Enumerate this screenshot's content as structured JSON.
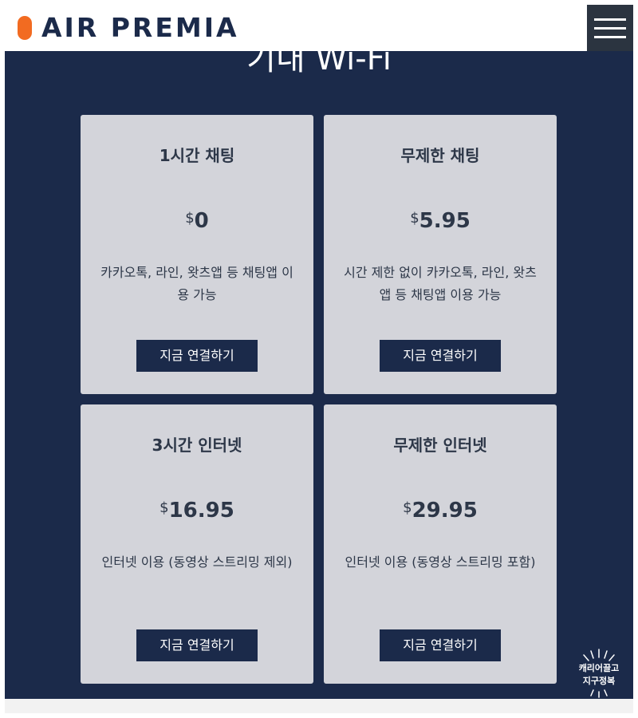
{
  "header": {
    "logo_text": "AIR PREMIA",
    "menu_icon": "hamburger-menu-icon",
    "brand_color": "#f26b21"
  },
  "section": {
    "title": "기내 Wi-Fi"
  },
  "plans": [
    {
      "title": "1시간 채팅",
      "currency": "$",
      "price": "0",
      "description": "카카오톡, 라인, 왓츠앱 등 채팅앱 이용 가능",
      "button_label": "지금 연결하기"
    },
    {
      "title": "무제한 채팅",
      "currency": "$",
      "price": "5.95",
      "description": "시간 제한 없이 카카오톡, 라인, 왓츠앱 등 채팅앱 이용 가능",
      "button_label": "지금 연결하기"
    },
    {
      "title": "3시간 인터넷",
      "currency": "$",
      "price": "16.95",
      "description": "인터넷 이용 (동영상 스트리밍 제외)",
      "button_label": "지금 연결하기"
    },
    {
      "title": "무제한 인터넷",
      "currency": "$",
      "price": "29.95",
      "description": "인터넷 이용 (동영상 스트리밍 포함)",
      "button_label": "지금 연결하기"
    }
  ],
  "badge": {
    "line1": "캐리어끌고",
    "line2": "지구정복"
  },
  "colors": {
    "navy": "#1b2a4a",
    "card": "#d3d4da",
    "text": "#2d3748"
  }
}
